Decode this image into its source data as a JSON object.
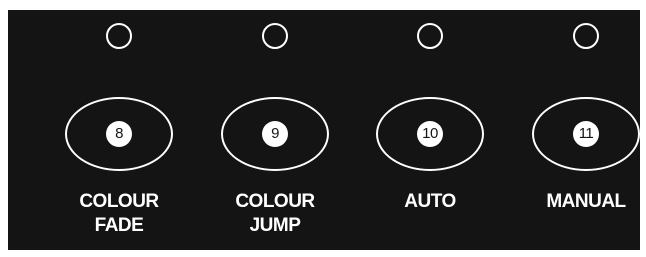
{
  "colors": {
    "panel": "#141414",
    "foreground": "#ffffff"
  },
  "buttons": [
    {
      "number": "8",
      "label_line1": "COLOUR",
      "label_line2": "FADE",
      "indicator": "off"
    },
    {
      "number": "9",
      "label_line1": "COLOUR",
      "label_line2": "JUMP",
      "indicator": "off"
    },
    {
      "number": "10",
      "label_line1": "AUTO",
      "label_line2": "",
      "indicator": "off"
    },
    {
      "number": "11",
      "label_line1": "MANUAL",
      "label_line2": "",
      "indicator": "off"
    }
  ]
}
